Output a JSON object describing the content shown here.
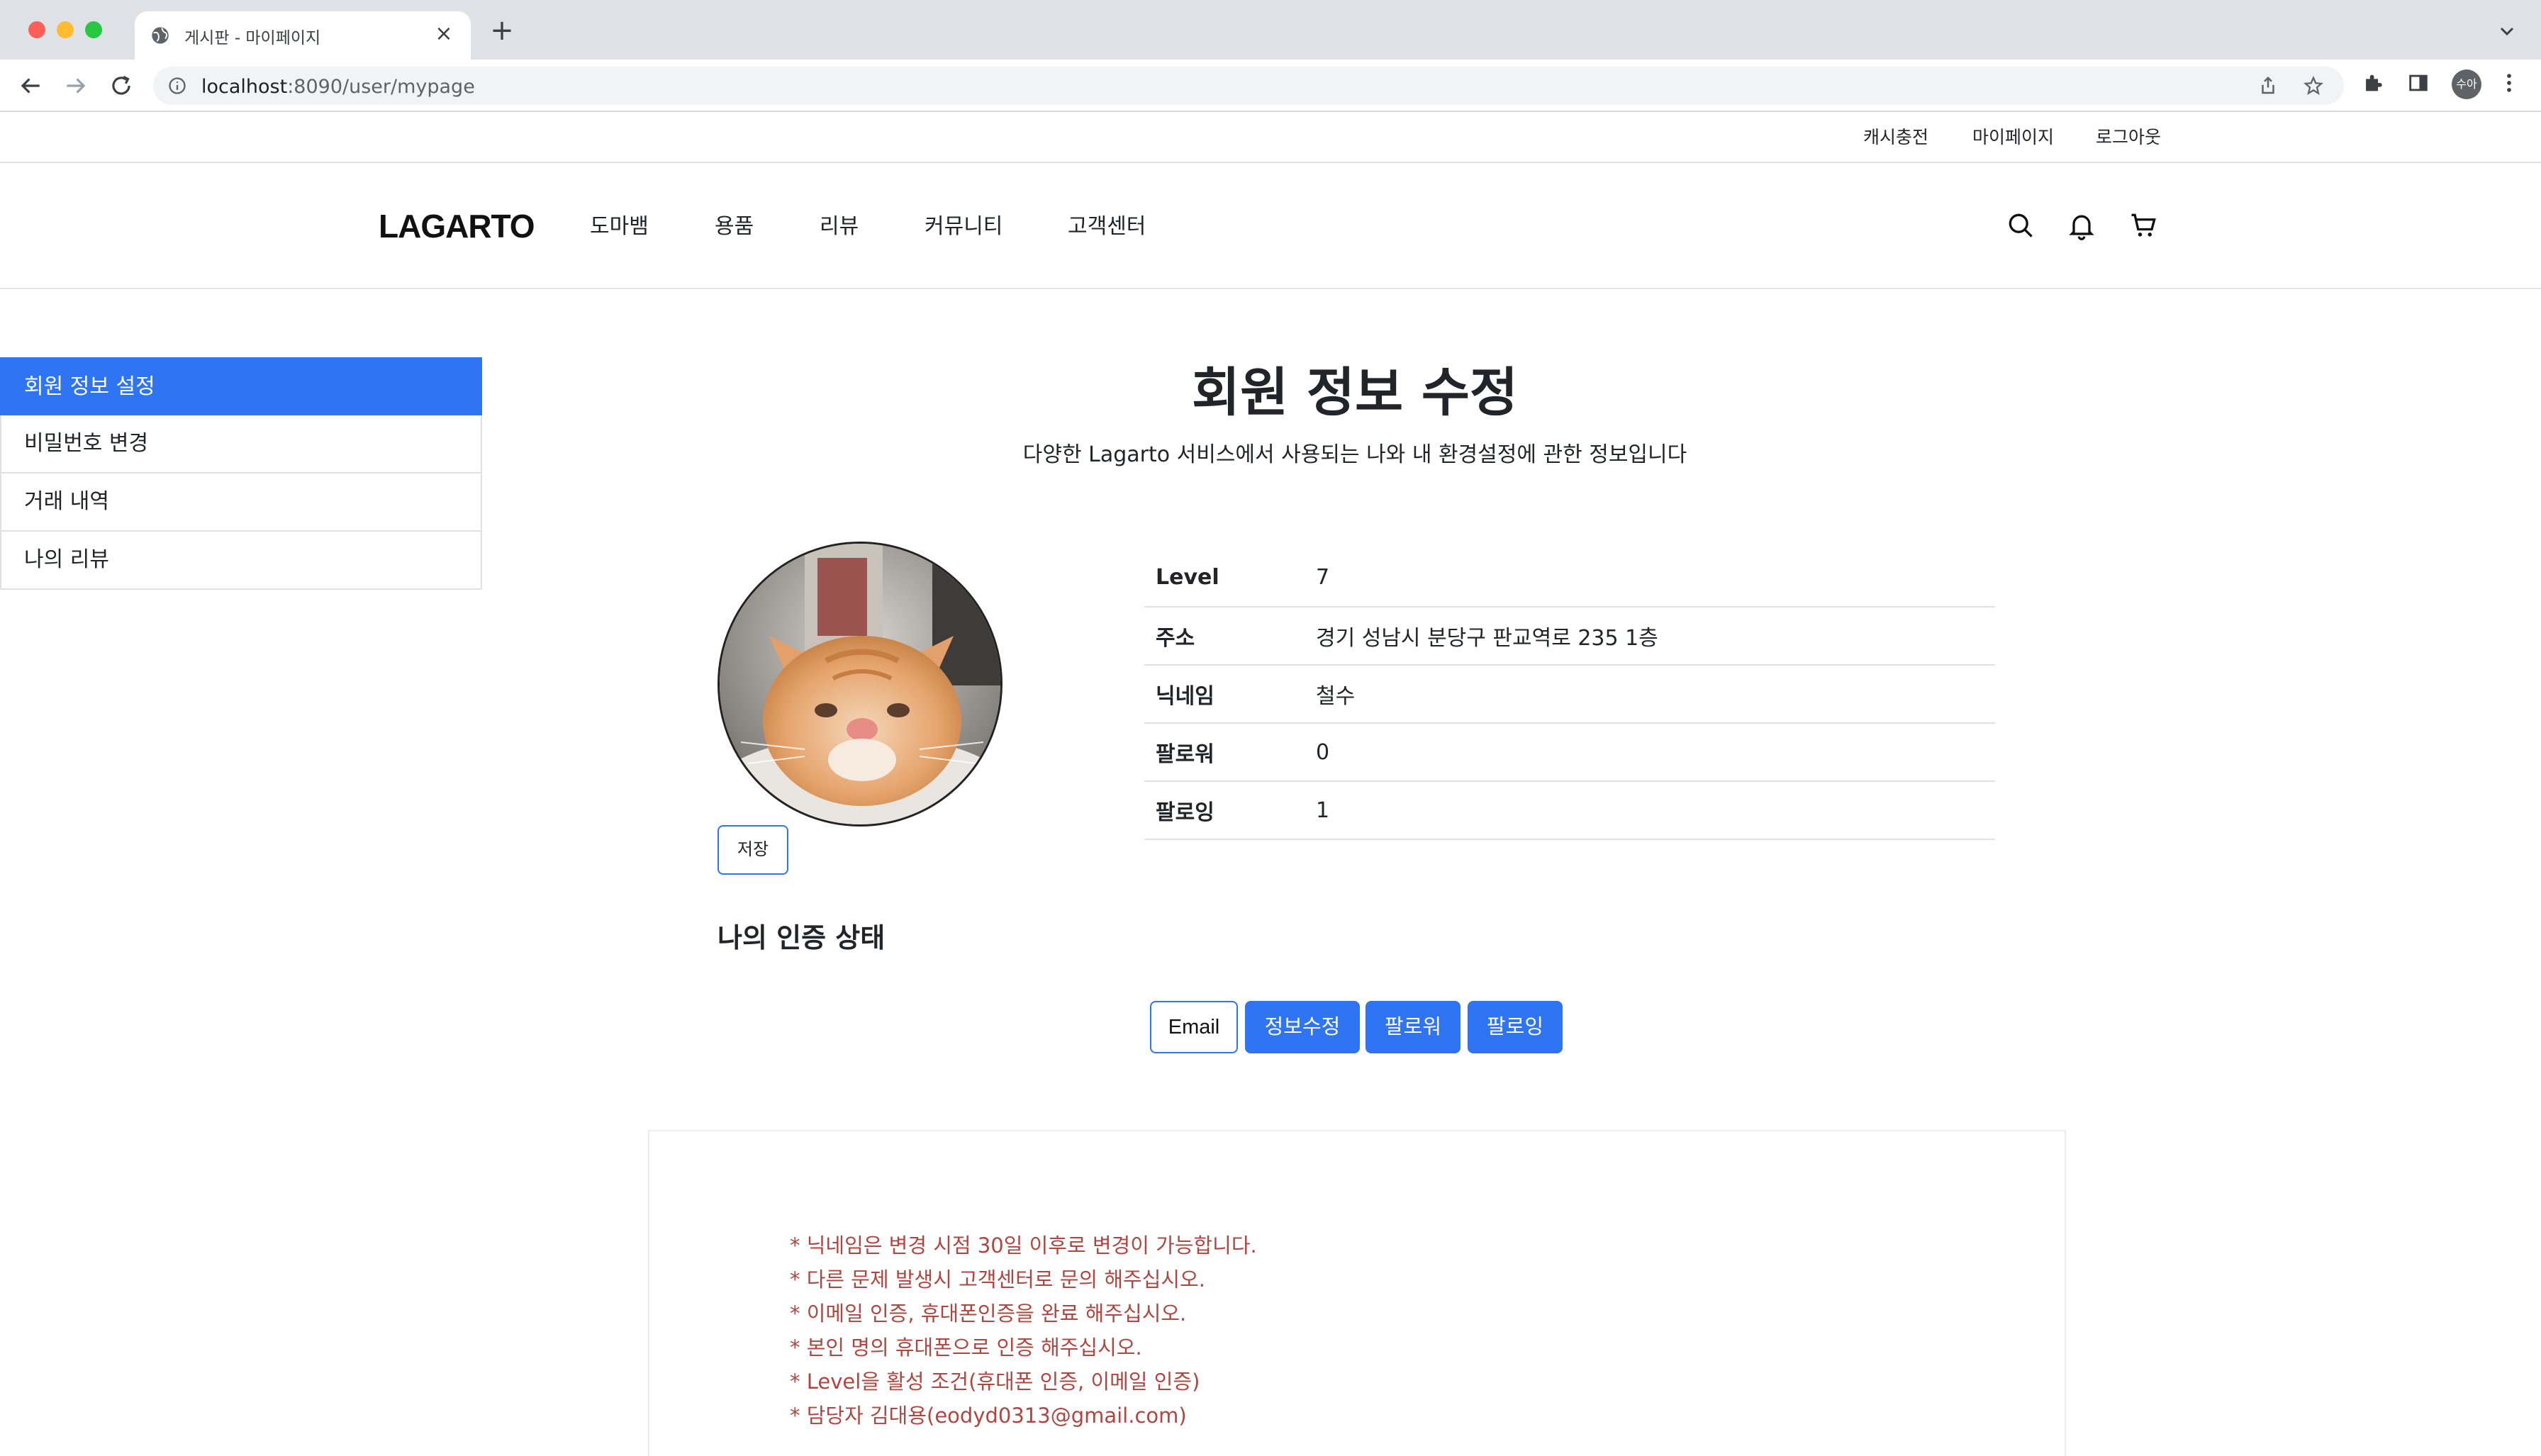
{
  "browser": {
    "tab_title": "게시판 - 마이페이지",
    "url_host": "localhost",
    "url_path": ":8090/user/mypage",
    "profile_initials": "수아"
  },
  "util_links": [
    "캐시충전",
    "마이페이지",
    "로그아웃"
  ],
  "header": {
    "logo": "LAGARTO",
    "nav": [
      "도마뱀",
      "용품",
      "리뷰",
      "커뮤니티",
      "고객센터"
    ]
  },
  "sidebar": {
    "items": [
      {
        "label": "회원 정보 설정",
        "active": true
      },
      {
        "label": "비밀번호 변경",
        "active": false
      },
      {
        "label": "거래 내역",
        "active": false
      },
      {
        "label": "나의 리뷰",
        "active": false
      }
    ]
  },
  "main": {
    "title": "회원 정보 수정",
    "description": "다양한 Lagarto 서비스에서 사용되는 나와 내 환경설정에 관한 정보입니다",
    "save_label": "저장",
    "info": [
      {
        "key": "Level",
        "value": "7"
      },
      {
        "key": "주소",
        "value": "경기 성남시 분당구 판교역로 235 1층"
      },
      {
        "key": "닉네임",
        "value": "철수"
      },
      {
        "key": "팔로워",
        "value": "0"
      },
      {
        "key": "팔로잉",
        "value": "1"
      }
    ],
    "auth_title": "나의 인증 상태",
    "auth_buttons": [
      "Email",
      "정보수정",
      "팔로워",
      "팔로잉"
    ]
  },
  "notices": [
    "* 닉네임은 변경 시점 30일 이후로 변경이 가능합니다.",
    "* 다른 문제 발생시 고객센터로 문의 해주십시오.",
    "* 이메일 인증, 휴대폰인증을 완료 해주십시오.",
    "* 본인 명의 휴대폰으로 인증 해주십시오.",
    "* Level을 활성 조건(휴대폰 인증, 이메일 인증)",
    "* 담당자 김대용(eodyd0313@gmail.com)"
  ],
  "colors": {
    "accent": "#2f74f2",
    "notice": "#b0463f"
  }
}
